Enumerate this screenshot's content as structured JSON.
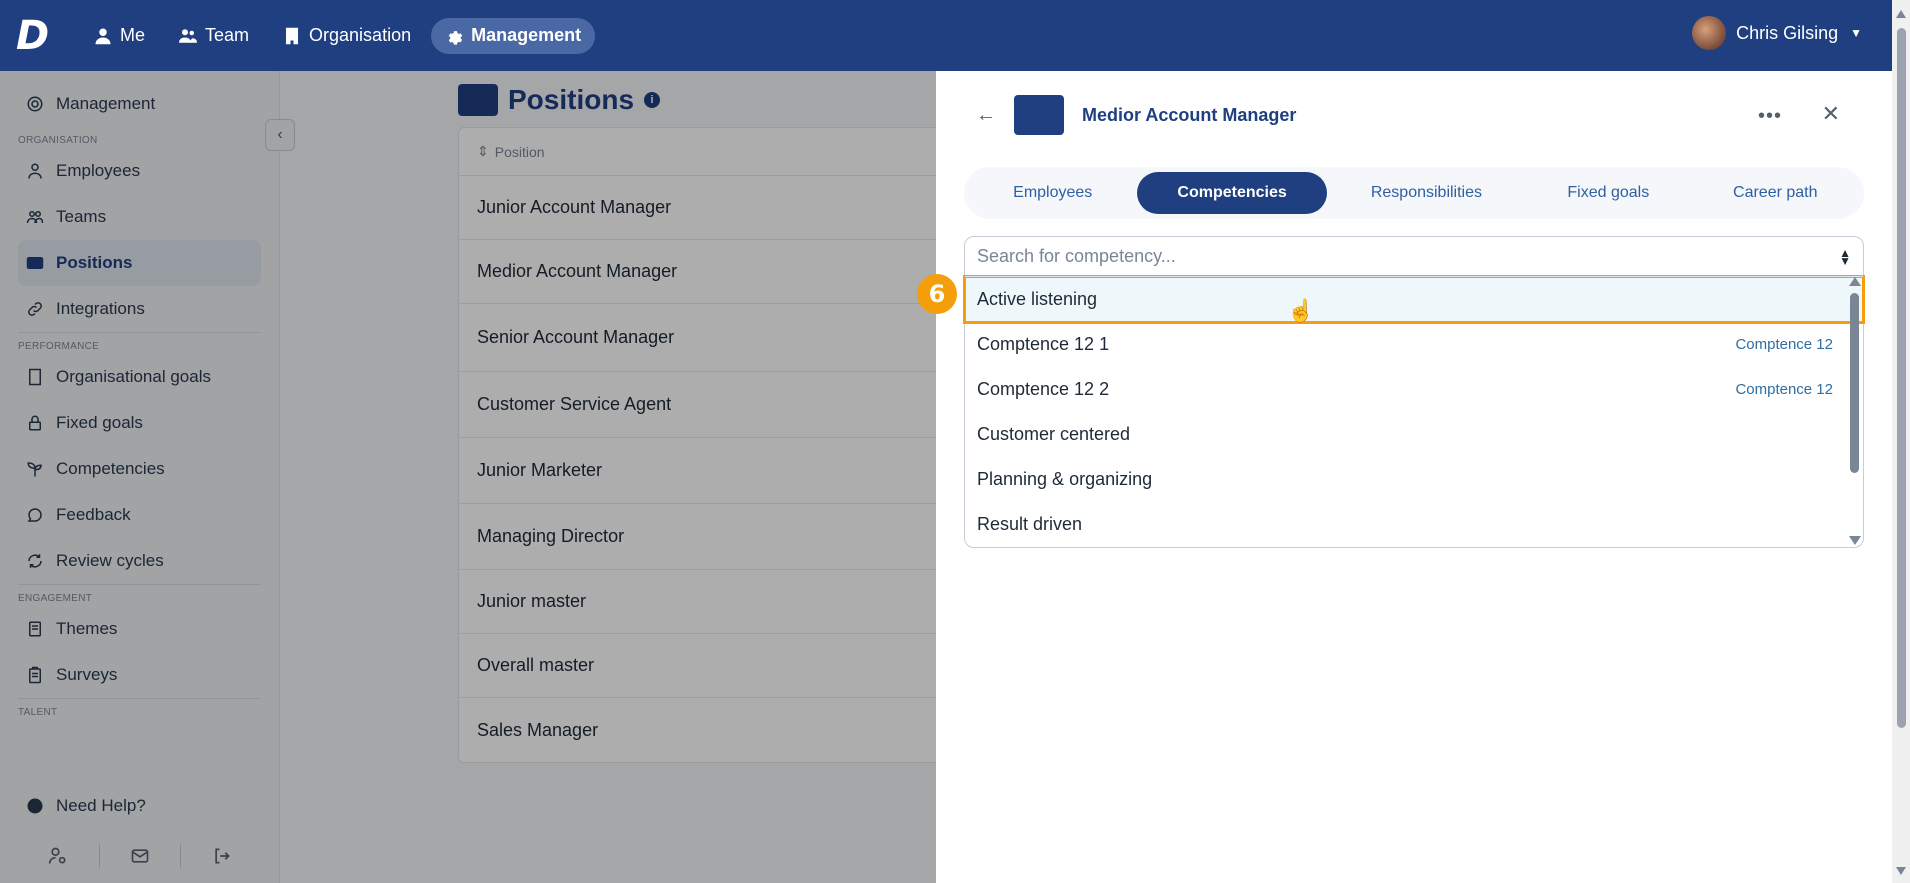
{
  "topbar": {
    "logo": "D",
    "nav": [
      {
        "label": "Me",
        "icon": "user-icon"
      },
      {
        "label": "Team",
        "icon": "users-icon"
      },
      {
        "label": "Organisation",
        "icon": "building-icon"
      },
      {
        "label": "Management",
        "icon": "gear-icon",
        "active": true
      }
    ],
    "user_name": "Chris Gilsing"
  },
  "sidebar": {
    "header": "Management",
    "sections": [
      {
        "title": "ORGANISATION",
        "items": [
          "Employees",
          "Teams",
          "Positions",
          "Integrations"
        ]
      },
      {
        "title": "PERFORMANCE",
        "items": [
          "Organisational goals",
          "Fixed goals",
          "Competencies",
          "Feedback",
          "Review cycles"
        ]
      },
      {
        "title": "ENGAGEMENT",
        "items": [
          "Themes",
          "Surveys"
        ]
      },
      {
        "title": "TALENT",
        "items": []
      }
    ],
    "active_item": "Positions",
    "help": "Need Help?"
  },
  "main": {
    "title": "Positions",
    "table": {
      "header": "Position",
      "rows": [
        "Junior Account Manager",
        "Medior Account Manager",
        "Senior Account Manager",
        "Customer Service Agent",
        "Junior Marketer",
        "Managing Director",
        "Junior master",
        "Overall master",
        "Sales Manager"
      ]
    }
  },
  "panel": {
    "title": "Medior Account Manager",
    "tabs": [
      "Employees",
      "Competencies",
      "Responsibilities",
      "Fixed goals",
      "Career path"
    ],
    "active_tab": "Competencies",
    "search_placeholder": "Search for competency...",
    "options": [
      {
        "label": "Active listening",
        "group": ""
      },
      {
        "label": "Comptence 12 1",
        "group": "Comptence 12"
      },
      {
        "label": "Comptence 12 2",
        "group": "Comptence 12"
      },
      {
        "label": "Customer centered",
        "group": ""
      },
      {
        "label": "Planning & organizing",
        "group": ""
      },
      {
        "label": "Result driven",
        "group": ""
      }
    ]
  },
  "annotation": {
    "step": "6"
  },
  "colors": {
    "brand": "#1f3f80",
    "highlight": "#f59e0b",
    "accent_text": "#2f6ea3"
  }
}
